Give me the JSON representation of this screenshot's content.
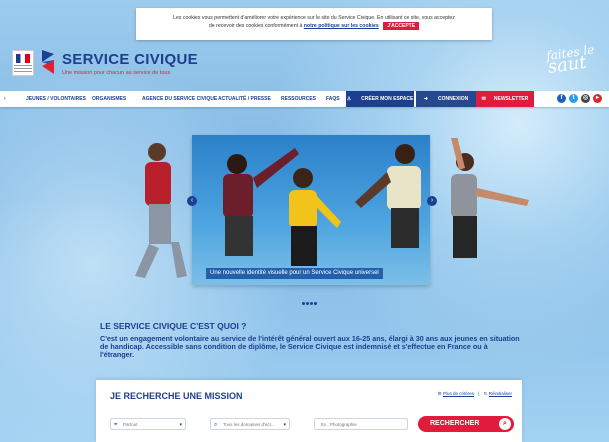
{
  "cookie": {
    "line1": "Les cookies vous permettent d'améliorer votre expérience sur le site du Service Civique. En utilisant ce site, vous acceptez",
    "line2": "de recevoir des cookies conformément à",
    "link": "notre politique sur les cookies",
    "accept": "J'ACCEPTE"
  },
  "header": {
    "brand_title": "SERVICE CIVIQUE",
    "brand_tagline": "Une mission pour chacun au service de tous",
    "slogan_line1": "faites le",
    "slogan_line2": "saut"
  },
  "nav": {
    "items": [
      "JEUNES / VOLONTAIRES",
      "ORGANISMES",
      "AGENCE DU SERVICE CIVIQUE",
      "ACTUALITÉ / PRESSE",
      "RESSOURCES",
      "FAQS"
    ],
    "create_space": "CRÉER MON ESPACE",
    "login": "CONNEXION",
    "newsletter": "NEWSLETTER",
    "social_icons": [
      "facebook-icon",
      "twitter-icon",
      "instagram-icon",
      "youtube-icon"
    ]
  },
  "hero": {
    "caption": "Une nouvelle identité visuelle pour un Service Civique universel",
    "slides": 4
  },
  "intro": {
    "title": "LE SERVICE CIVIQUE C'EST QUOI ?",
    "text": "C'est un engagement volontaire au service de l'intérêt général ouvert aux 16-25 ans, élargi à 30 ans aux jeunes en situation de handicap. Accessible sans condition de diplôme, le Service Civique est indemnisé et s'effectue en France ou à l'étranger."
  },
  "search": {
    "title": "JE RECHERCHE UNE MISSION",
    "link_criteria": "Plus de critères",
    "separator": "|",
    "link_reset": "Réinitialiser",
    "field_where_placeholder": "Partout",
    "field_domain_placeholder": "Tous les domaines d'act...",
    "field_keyword_placeholder": "Ex : Photographie",
    "button": "RECHERCHER"
  },
  "colors": {
    "navy": "#1d3f8f",
    "red": "#e01b3c"
  }
}
